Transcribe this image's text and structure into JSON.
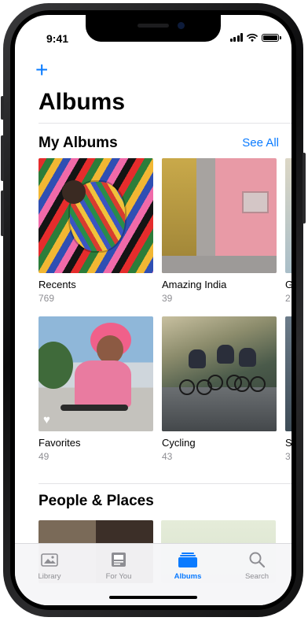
{
  "status_bar": {
    "time": "9:41"
  },
  "header": {
    "add_symbol": "+",
    "title": "Albums"
  },
  "my_albums": {
    "title": "My Albums",
    "see_all_label": "See All",
    "row1": [
      {
        "name": "Recents",
        "count": "769"
      },
      {
        "name": "Amazing India",
        "count": "39"
      },
      {
        "name": "G",
        "count": "2"
      }
    ],
    "row2": [
      {
        "name": "Favorites",
        "count": "49"
      },
      {
        "name": "Cycling",
        "count": "43"
      },
      {
        "name": "S",
        "count": "3"
      }
    ]
  },
  "people_places": {
    "title": "People & Places"
  },
  "tab_bar": {
    "tabs": [
      {
        "label": "Library",
        "icon": "library-icon"
      },
      {
        "label": "For You",
        "icon": "for-you-icon"
      },
      {
        "label": "Albums",
        "icon": "albums-icon",
        "active": true
      },
      {
        "label": "Search",
        "icon": "search-icon"
      }
    ]
  },
  "colors": {
    "accent": "#0a7bff",
    "secondary_text": "#8e8e93"
  }
}
